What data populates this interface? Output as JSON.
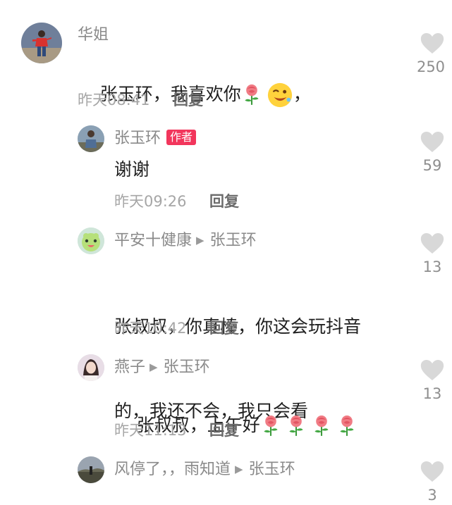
{
  "comments": [
    {
      "username": "华姐",
      "text": "张玉环，我喜欢你",
      "text_suffix": "，",
      "time": "昨天08:41",
      "reply_label": "回复",
      "likes": "250"
    },
    {
      "username": "张玉环",
      "badge": "作者",
      "text": "谢谢",
      "time": "昨天09:26",
      "reply_label": "回复",
      "likes": "59"
    },
    {
      "username": "平安十健康",
      "reply_to": "张玉环",
      "text_line1": "张叔叔，你真棒，你这会玩抖音",
      "text_line2": "的，我还不会，我只会看",
      "time": "昨天10:42",
      "reply_label": "回复",
      "likes": "13"
    },
    {
      "username": "燕子",
      "reply_to": "张玉环",
      "text": "张叔叔，上午好",
      "time": "昨天11:13",
      "reply_label": "回复",
      "likes": "13"
    },
    {
      "username": "风停了，，雨知道",
      "reply_to": "张玉环",
      "likes": "3"
    }
  ],
  "icons": {
    "like": "heart-icon",
    "emoji_rose": "rose-emoji-icon",
    "emoji_wink": "wink-emoji-icon",
    "reply_arrow": "play-triangle-icon"
  },
  "colors": {
    "author_badge": "#f2365c",
    "heart": "#d8d8d8"
  }
}
